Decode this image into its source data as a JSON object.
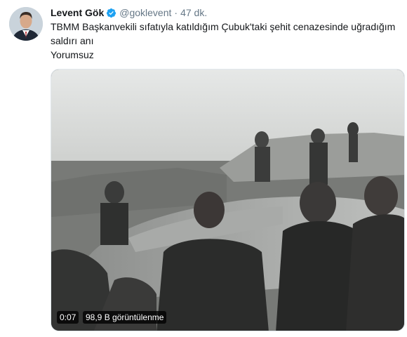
{
  "tweet": {
    "author": {
      "name": "Levent Gök",
      "handle": "@goklevent",
      "avatar_icon": "profile-photo",
      "verified_icon": "verified-badge-icon"
    },
    "separator": "·",
    "timestamp": "47 dk.",
    "text_line1": "TBMM Başkanvekili sıfatıyla katıldığım Çubuk'taki şehit cenazesinde uğradığım",
    "text_line2": "saldırı anı",
    "text_line3": "Yorumsuz",
    "video": {
      "duration": "0:07",
      "views": "98,9 B görüntülenme"
    }
  },
  "colors": {
    "text": "#14171a",
    "secondary": "#657786",
    "verified": "#1da1f2",
    "badge_bg": "#000000"
  }
}
